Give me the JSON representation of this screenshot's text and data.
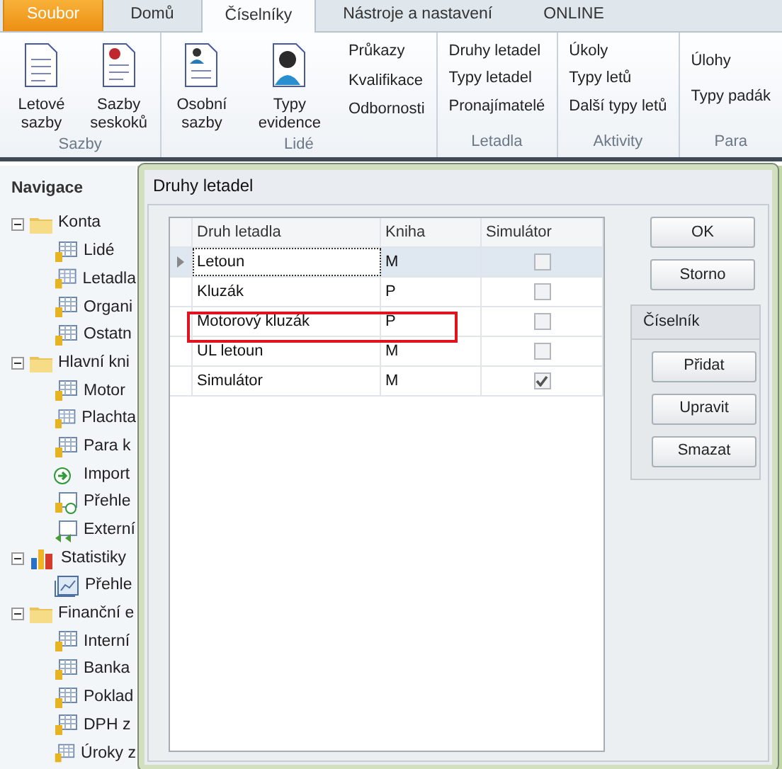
{
  "ribbon_tabs": [
    {
      "label": "Soubor",
      "kind": "file",
      "selected": false
    },
    {
      "label": "Domů",
      "kind": "tab",
      "selected": false
    },
    {
      "label": "Číselníky",
      "kind": "tab",
      "selected": true
    },
    {
      "label": "Nástroje a nastavení",
      "kind": "tab",
      "selected": false
    },
    {
      "label": "ONLINE",
      "kind": "tab",
      "selected": false
    }
  ],
  "ribbon_groups": [
    {
      "title": "Sazby",
      "items": [
        {
          "kind": "large",
          "label": "Letové sazby"
        },
        {
          "kind": "large",
          "label": "Sazby seskoků"
        }
      ]
    },
    {
      "title": "Lidé",
      "items": [
        {
          "kind": "large",
          "label": "Osobní sazby"
        },
        {
          "kind": "large",
          "label": "Typy evidence"
        },
        {
          "kind": "column",
          "labels": [
            "Průkazy",
            "Kvalifikace",
            "Odbornosti"
          ]
        }
      ]
    },
    {
      "title": "Letadla",
      "items": [
        {
          "kind": "column",
          "labels": [
            "Druhy letadel",
            "Typy letadel",
            "Pronajímatelé"
          ]
        }
      ]
    },
    {
      "title": "Aktivity",
      "items": [
        {
          "kind": "column",
          "labels": [
            "Úkoly",
            "Typy letů",
            "Další typy letů"
          ]
        }
      ]
    },
    {
      "title": "Para",
      "items": [
        {
          "kind": "column2",
          "labels": [
            "Úlohy",
            "Typy padák"
          ]
        }
      ]
    }
  ],
  "navigation": {
    "title": "Navigace",
    "items": [
      {
        "label": "Konta",
        "expanded": true,
        "children": [
          {
            "label": "Lidé"
          },
          {
            "label": "Letadla"
          },
          {
            "label": "Organi"
          },
          {
            "label": "Ostatn"
          }
        ]
      },
      {
        "label": "Hlavní kni",
        "expanded": true,
        "children": [
          {
            "label": "Motor"
          },
          {
            "label": "Plachta"
          },
          {
            "label": "Para k"
          },
          {
            "label": "Import"
          },
          {
            "label": "Přehle"
          },
          {
            "label": "Externí"
          }
        ]
      },
      {
        "label": "Statistiky",
        "expanded": true,
        "children": [
          {
            "label": "Přehle"
          }
        ]
      },
      {
        "label": "Finanční e",
        "expanded": true,
        "children": [
          {
            "label": "Interní"
          },
          {
            "label": "Banka"
          },
          {
            "label": "Poklad"
          },
          {
            "label": "DPH z"
          },
          {
            "label": "Úroky z"
          }
        ]
      }
    ]
  },
  "dialog": {
    "title": "Druhy letadel",
    "columns": [
      "Druh letadla",
      "Kniha",
      "Simulátor"
    ],
    "rows": [
      {
        "name": "Letoun",
        "book": "M",
        "simulator": false,
        "selected": true,
        "highlighted": false
      },
      {
        "name": "Kluzák",
        "book": "P",
        "simulator": false,
        "selected": false,
        "highlighted": false
      },
      {
        "name": "Motorový kluzák",
        "book": "P",
        "simulator": false,
        "selected": false,
        "highlighted": true
      },
      {
        "name": "UL letoun",
        "book": "M",
        "simulator": false,
        "selected": false,
        "highlighted": false
      },
      {
        "name": "Simulátor",
        "book": "M",
        "simulator": true,
        "selected": false,
        "highlighted": false
      }
    ],
    "buttons": [
      "OK",
      "Storno"
    ],
    "group": {
      "title": "Číselník",
      "buttons": [
        "Přidat",
        "Upravit",
        "Smazat"
      ]
    }
  }
}
